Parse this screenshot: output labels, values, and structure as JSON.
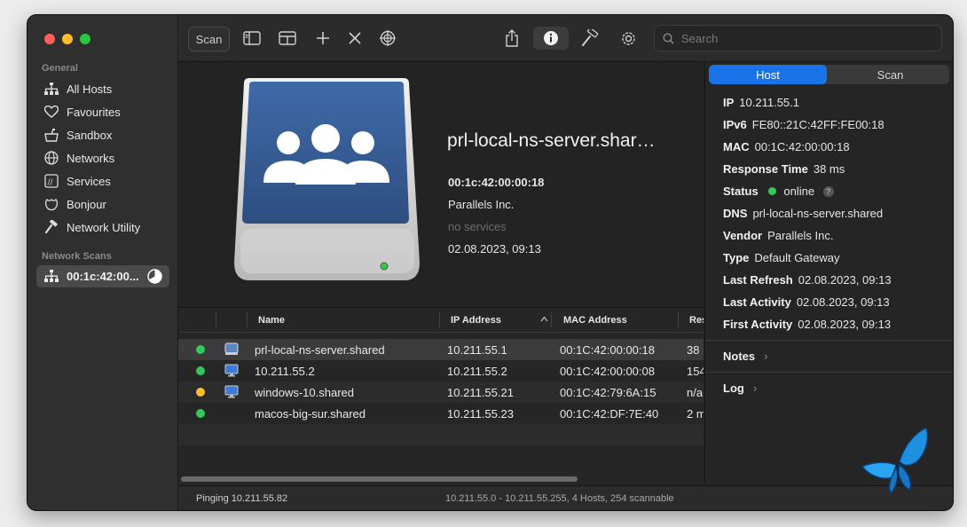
{
  "sidebar": {
    "section_general": "General",
    "items": [
      {
        "label": "All Hosts",
        "icon": "network-icon"
      },
      {
        "label": "Favourites",
        "icon": "heart-icon"
      },
      {
        "label": "Sandbox",
        "icon": "sandbox-icon"
      },
      {
        "label": "Networks",
        "icon": "globe-icon"
      },
      {
        "label": "Services",
        "icon": "services-icon"
      },
      {
        "label": "Bonjour",
        "icon": "bonjour-icon"
      },
      {
        "label": "Network Utility",
        "icon": "hammer-icon"
      }
    ],
    "section_scans": "Network Scans",
    "scan_item": "00:1c:42:00..."
  },
  "toolbar": {
    "scan_label": "Scan",
    "search_placeholder": "Search"
  },
  "hero": {
    "title": "prl-local-ns-server.shar…",
    "mac": "00:1c:42:00:00:18",
    "vendor": "Parallels Inc.",
    "services": "no services",
    "date": "02.08.2023, 09:13"
  },
  "table": {
    "headers": {
      "name": "Name",
      "ip": "IP Address",
      "mac": "MAC Address",
      "res": "Res"
    },
    "rows": [
      {
        "name": "prl-local-ns-server.shared",
        "ip": "10.211.55.1",
        "mac": "00:1C:42:00:00:18",
        "res": "38",
        "status": "green",
        "icon": "server-icon"
      },
      {
        "name": "10.211.55.2",
        "ip": "10.211.55.2",
        "mac": "00:1C:42:00:00:08",
        "res": "154",
        "status": "green",
        "icon": "monitor-icon"
      },
      {
        "name": "windows-10.shared",
        "ip": "10.211.55.21",
        "mac": "00:1C:42:79:6A:15",
        "res": "n/a",
        "status": "yellow",
        "icon": "monitor-icon"
      },
      {
        "name": "macos-big-sur.shared",
        "ip": "10.211.55.23",
        "mac": "00:1C:42:DF:7E:40",
        "res": "2 m",
        "status": "green",
        "icon": ""
      }
    ]
  },
  "status": {
    "left": "Pinging 10.211.55.82",
    "center": "10.211.55.0 - 10.211.55.255, 4 Hosts, 254 scannable"
  },
  "inspector": {
    "tab_host": "Host",
    "tab_scan": "Scan",
    "ip_label": "IP",
    "ip": "10.211.55.1",
    "ipv6_label": "IPv6",
    "ipv6": "FE80::21C:42FF:FE00:18",
    "mac_label": "MAC",
    "mac": "00:1C:42:00:00:18",
    "resp_label": "Response Time",
    "resp": "38 ms",
    "status_label": "Status",
    "status": "online",
    "dns_label": "DNS",
    "dns": "prl-local-ns-server.shared",
    "vendor_label": "Vendor",
    "vendor": "Parallels Inc.",
    "type_label": "Type",
    "type": "Default Gateway",
    "refresh_label": "Last Refresh",
    "refresh": "02.08.2023, 09:13",
    "activity_label": "Last Activity",
    "activity": "02.08.2023, 09:13",
    "first_label": "First Activity",
    "first": "02.08.2023, 09:13",
    "notes": "Notes",
    "log": "Log"
  },
  "colors": {
    "accent": "#1a73e8",
    "online": "#34c759",
    "warning": "#febc2e"
  }
}
